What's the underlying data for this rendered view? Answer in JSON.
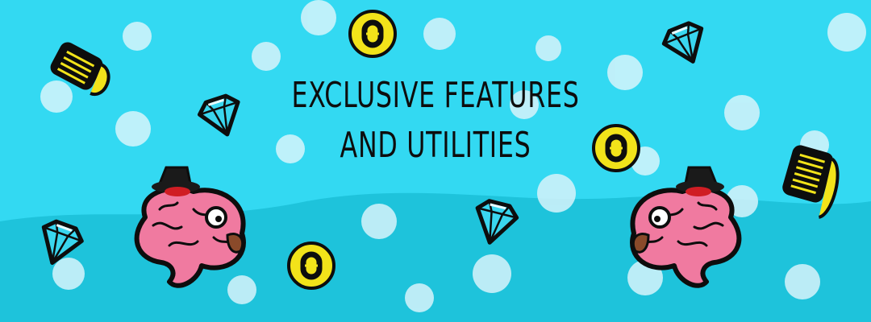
{
  "banner": {
    "title_line1": "Exclusive features",
    "title_line2": "and utilities",
    "colors": {
      "sky": "#33d9f2",
      "sky_lower": "#1ec3db",
      "bubble": "#d7f4fb",
      "coin": "#f2e31a",
      "diamond": "#3ad6ef",
      "brain": "#f07aa0",
      "outline": "#0d0d0d"
    },
    "icons": [
      "coin-icon",
      "diamond-icon",
      "coin-stack-icon",
      "brain-with-hat-icon"
    ]
  }
}
